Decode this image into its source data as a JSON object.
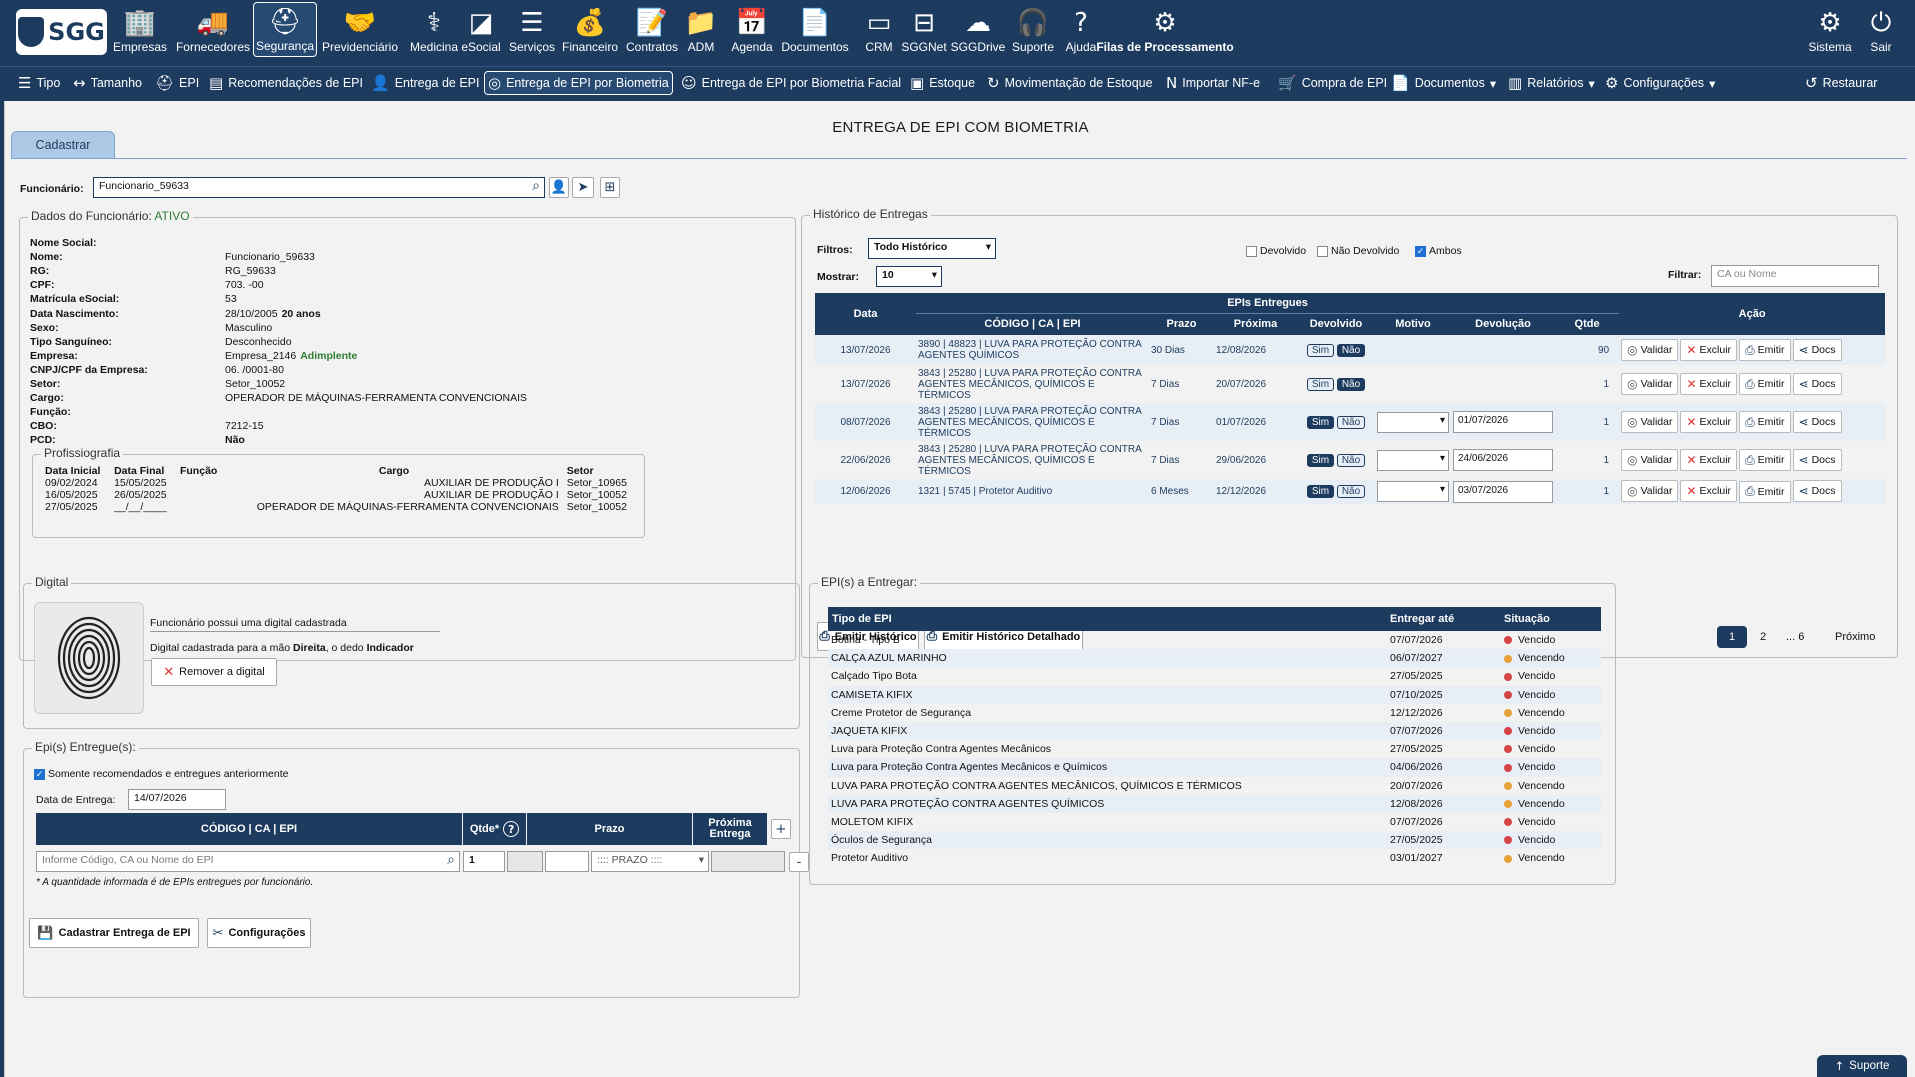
{
  "brand": {
    "logo_text": "SGG"
  },
  "topnav": {
    "items": [
      {
        "label": "Empresas",
        "icon": "building-icon"
      },
      {
        "label": "Fornecedores",
        "icon": "truck-icon"
      },
      {
        "label": "Segurança",
        "icon": "helmet-icon"
      },
      {
        "label": "Previdenciário",
        "icon": "handshake-icon"
      },
      {
        "label": "Medicina",
        "icon": "stethoscope-icon"
      },
      {
        "label": "eSocial",
        "icon": "esocial-icon"
      },
      {
        "label": "Serviços",
        "icon": "layers-icon"
      },
      {
        "label": "Financeiro",
        "icon": "money-bag-icon"
      },
      {
        "label": "Contratos",
        "icon": "contract-icon"
      },
      {
        "label": "ADM",
        "icon": "folder-user-icon"
      },
      {
        "label": "Agenda",
        "icon": "calendar-icon"
      },
      {
        "label": "Documentos",
        "icon": "document-icon"
      },
      {
        "label": "CRM",
        "icon": "crm-icon"
      },
      {
        "label": "SGGNet",
        "icon": "net-icon"
      },
      {
        "label": "SGGDrive",
        "icon": "cloud-icon"
      },
      {
        "label": "Suporte",
        "icon": "headset-icon"
      },
      {
        "label": "Ajuda",
        "icon": "question-bubble-icon"
      },
      {
        "label": "Filas de Processamento",
        "icon": "queue-icon"
      }
    ],
    "sistema": "Sistema",
    "sair": "Sair",
    "active": "Segurança"
  },
  "subnav": {
    "items": [
      "Tipo",
      "Tamanho",
      "EPI",
      "Recomendações de EPI",
      "Entrega de EPI",
      "Entrega de EPI por Biometria",
      "Entrega de EPI por Biometria Facial",
      "Estoque",
      "Movimentação de Estoque",
      "Importar NF-e",
      "Compra de EPI",
      "Documentos",
      "Relatórios",
      "Configurações"
    ],
    "restaurar": "Restaurar",
    "active": "Entrega de EPI por Biometria"
  },
  "page": {
    "title": "ENTREGA DE EPI COM BIOMETRIA",
    "tab": "Cadastrar"
  },
  "funcionario": {
    "label": "Funcionário:",
    "value": "Funcionario_59633"
  },
  "dados": {
    "legend": "Dados do Funcionário:",
    "status": "ATIVO",
    "fields": [
      {
        "label": "Nome Social:",
        "value": ""
      },
      {
        "label": "Nome:",
        "value": "Funcionario_59633"
      },
      {
        "label": "RG:",
        "value": "RG_59633"
      },
      {
        "label": "CPF:",
        "value": "703.            -00"
      },
      {
        "label": "Matrícula eSocial:",
        "value": "53"
      },
      {
        "label": "Data Nascimento:",
        "value": "28/10/2005",
        "extra": "20 anos"
      },
      {
        "label": "Sexo:",
        "value": "Masculino"
      },
      {
        "label": "Tipo Sanguíneo:",
        "value": "Desconhecido"
      },
      {
        "label": "Empresa:",
        "value": "Empresa_2146",
        "extra": "Adimplente"
      },
      {
        "label": "CNPJ/CPF da Empresa:",
        "value": "06.          /0001-80"
      },
      {
        "label": "Setor:",
        "value": "Setor_10052"
      },
      {
        "label": "Cargo:",
        "value": "OPERADOR DE MÁQUINAS-FERRAMENTA CONVENCIONAIS"
      },
      {
        "label": "Função:",
        "value": ""
      },
      {
        "label": "CBO:",
        "value": "7212-15"
      },
      {
        "label": "PCD:",
        "value": "Não"
      }
    ]
  },
  "profissiografia": {
    "legend": "Profissiografia",
    "headers": [
      "Data Inicial",
      "Data Final",
      "Função",
      "Cargo",
      "Setor"
    ],
    "rows": [
      [
        "09/02/2024",
        "15/05/2025",
        "",
        "AUXILIAR DE PRODUÇÃO I",
        "Setor_10965"
      ],
      [
        "16/05/2025",
        "26/05/2025",
        "",
        "AUXILIAR DE PRODUÇÃO I",
        "Setor_10052"
      ],
      [
        "27/05/2025",
        "__/__/____",
        "",
        "OPERADOR DE MÁQUINAS-FERRAMENTA CONVENCIONAIS",
        "Setor_10052"
      ]
    ]
  },
  "digital": {
    "legend": "Digital",
    "msg1": "Funcionário possui uma digital cadastrada",
    "msg2_pre": "Digital cadastrada para a mão ",
    "msg2_hand": "Direita",
    "msg2_mid": ", o dedo ",
    "msg2_finger": "Indicador",
    "remove_btn": "Remover a digital"
  },
  "entregues": {
    "legend": "Epi(s) Entregue(s):",
    "checkbox_label": "Somente recomendados e entregues anteriormente",
    "data_label": "Data de Entrega:",
    "data_value": "14/07/2026",
    "headers": [
      "CÓDIGO | CA | EPI",
      "Qtde*",
      "Prazo",
      "Próxima Entrega"
    ],
    "epi_placeholder": "Informe Código, CA ou Nome do EPI",
    "qtde_value": "1",
    "prazo_option": ":::: PRAZO ::::",
    "note": "* A quantidade informada é de EPIs entregues por funcionário."
  },
  "buttons": {
    "cadastrar": "Cadastrar Entrega de EPI",
    "configuracoes": "Configurações"
  },
  "historico": {
    "legend": "Histórico de Entregas",
    "filtros_label": "Filtros:",
    "filtros_value": "Todo Histórico",
    "chk_devolvido": "Devolvido",
    "chk_nao_devolvido": "Não Devolvido",
    "chk_ambos": "Ambos",
    "mostrar_label": "Mostrar:",
    "mostrar_value": "10",
    "filtrar_label": "Filtrar:",
    "filtrar_placeholder": "CA ou Nome",
    "group_header": "EPIs Entregues",
    "headers": {
      "data": "Data",
      "codigo": "CÓDIGO | CA | EPI",
      "prazo": "Prazo",
      "proxima": "Próxima",
      "devolvido": "Devolvido",
      "motivo": "Motivo",
      "devolucao": "Devolução",
      "qtde": "Qtde",
      "acao": "Ação"
    },
    "rows": [
      {
        "data": "13/07/2026",
        "epi": "3890 | 48823 | LUVA PARA PROTEÇÃO CONTRA AGENTES QUÍMICOS",
        "prazo": "30 Dias",
        "proxima": "12/08/2026",
        "devolvido": "Não",
        "devolucao": "",
        "qtde": "90",
        "motivo_select": false
      },
      {
        "data": "13/07/2026",
        "epi": "3843 | 25280 | LUVA PARA PROTEÇÃO CONTRA AGENTES MECÂNICOS, QUÍMICOS E TÉRMICOS",
        "prazo": "7 Dias",
        "proxima": "20/07/2026",
        "devolvido": "Não",
        "devolucao": "",
        "qtde": "1",
        "motivo_select": false
      },
      {
        "data": "08/07/2026",
        "epi": "3843 | 25280 | LUVA PARA PROTEÇÃO CONTRA AGENTES MECÂNICOS, QUÍMICOS E TÉRMICOS",
        "prazo": "7 Dias",
        "proxima": "01/07/2026",
        "devolvido": "Sim",
        "devolucao": "01/07/2026",
        "qtde": "1",
        "motivo_select": true
      },
      {
        "data": "22/06/2026",
        "epi": "3843 | 25280 | LUVA PARA PROTEÇÃO CONTRA AGENTES MECÂNICOS, QUÍMICOS E TÉRMICOS",
        "prazo": "7 Dias",
        "proxima": "29/06/2026",
        "devolvido": "Sim",
        "devolucao": "24/06/2026",
        "qtde": "1",
        "motivo_select": true
      },
      {
        "data": "12/06/2026",
        "epi": "1321 | 5745 | Protetor Auditivo",
        "prazo": "6 Meses",
        "proxima": "12/12/2026",
        "devolvido": "Sim",
        "devolucao": "03/07/2026",
        "qtde": "1",
        "motivo_select": true
      }
    ],
    "chip_sim": "Sim",
    "chip_nao": "Não",
    "actions": {
      "validar": "Validar",
      "excluir": "Excluir",
      "emitir": "Emitir",
      "docs": "Docs"
    },
    "btn_emitir": "Emitir Histórico",
    "btn_emitir_det": "Emitir Histórico Detalhado",
    "pagination": {
      "current": "1",
      "p2": "2",
      "p6": "... 6",
      "next": "Próximo"
    }
  },
  "a_entregar": {
    "legend": "EPI(s) a Entregar:",
    "headers": [
      "Tipo de EPI",
      "Entregar até",
      "Situação"
    ],
    "status_colors": {
      "Vencido": "#d64545",
      "Vencendo": "#e8a23a"
    },
    "rows": [
      [
        "Botina - Tipo B",
        "07/07/2026",
        "Vencido"
      ],
      [
        "CALÇA AZUL MARINHO",
        "06/07/2027",
        "Vencendo"
      ],
      [
        "Calçado Tipo Bota",
        "27/05/2025",
        "Vencido"
      ],
      [
        "CAMISETA KIFIX",
        "07/10/2025",
        "Vencido"
      ],
      [
        "Creme Protetor de Segurança",
        "12/12/2026",
        "Vencendo"
      ],
      [
        "JAQUETA KIFIX",
        "07/07/2026",
        "Vencido"
      ],
      [
        "Luva para Proteção Contra Agentes Mecânicos",
        "27/05/2025",
        "Vencido"
      ],
      [
        "Luva para Proteção Contra Agentes Mecânicos e Químicos",
        "04/06/2026",
        "Vencido"
      ],
      [
        "LUVA PARA PROTEÇÃO CONTRA AGENTES MECÂNICOS, QUÍMICOS E TÉRMICOS",
        "20/07/2026",
        "Vencendo"
      ],
      [
        "LUVA PARA PROTEÇÃO CONTRA AGENTES QUÍMICOS",
        "12/08/2026",
        "Vencendo"
      ],
      [
        "MOLETOM KIFIX",
        "07/07/2026",
        "Vencido"
      ],
      [
        "Óculos de Segurança",
        "27/05/2025",
        "Vencido"
      ],
      [
        "Protetor Auditivo",
        "03/01/2027",
        "Vencendo"
      ]
    ]
  },
  "suporte_btn": "Suporte"
}
